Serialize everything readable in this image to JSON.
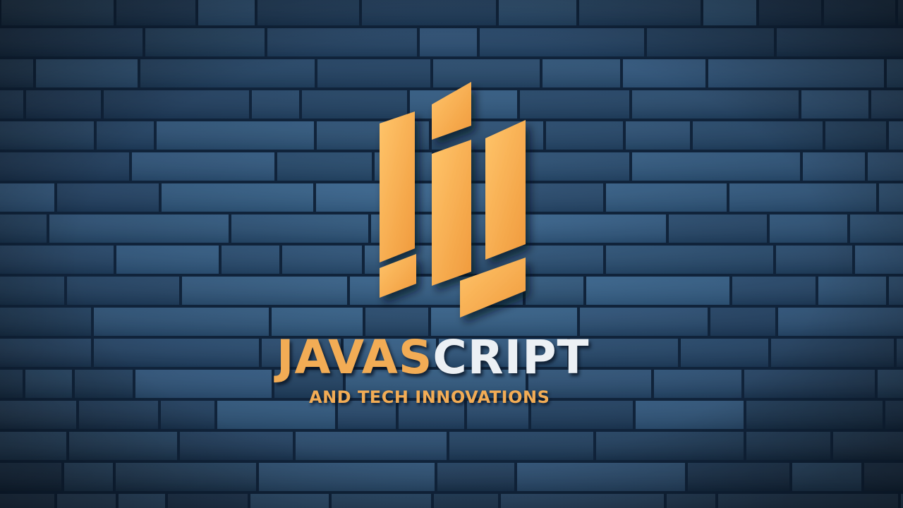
{
  "wordmark": {
    "title_part1": "JAVAS",
    "title_part2": "CRIPT",
    "subtitle": "AND TECH INNOVATIONS"
  },
  "colors": {
    "wall": "#1c3a57",
    "wall_light": "#2e577d",
    "logo_orange": "#f5ac4e",
    "logo_highlight": "#ffc56b",
    "title_white": "#ecf0f4"
  },
  "icons": {
    "emblem": "stylized-bar-shield-logo"
  }
}
